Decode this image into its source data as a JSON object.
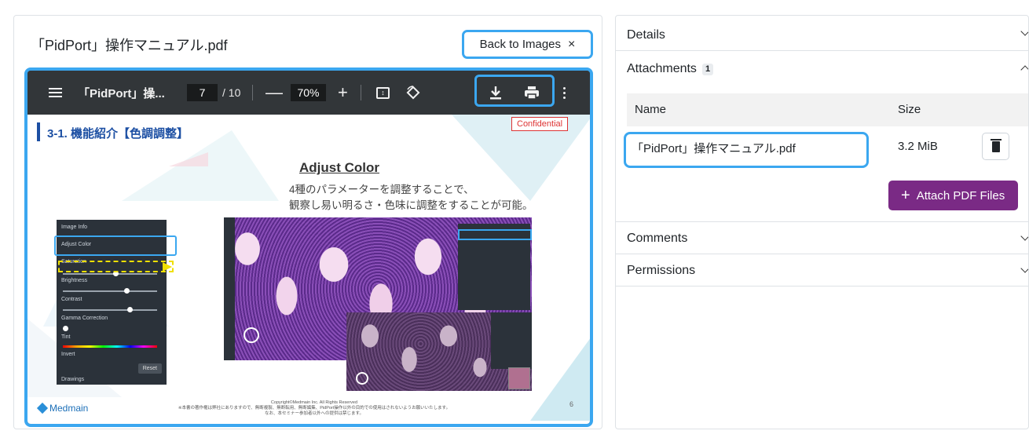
{
  "document": {
    "title": "「PidPort」操作マニュアル.pdf",
    "back_button": "Back to Images",
    "back_close": "×"
  },
  "viewer": {
    "title": "「PidPort」操...",
    "page_current": "7",
    "page_total": "/ 10",
    "zoom_minus": "—",
    "zoom": "70%",
    "zoom_plus": "+"
  },
  "pdf_page": {
    "section_title": "3-1. 機能紹介【色調調整】",
    "confidential": "Confidential",
    "heading": "Adjust Color",
    "desc_line1": "4種のパラメーターを調整することで、",
    "desc_line2": "観察し易い明るさ・色味に調整をすることが可能。",
    "panel": {
      "image_info": "Image Info",
      "adjust_color": "Adjust Color",
      "saturation": "Saturation",
      "brightness": "Brightness",
      "contrast": "Contrast",
      "gamma": "Gamma Correction",
      "tint": "Tint",
      "invert": "Invert",
      "reset": "Reset",
      "drawings": "Drawings"
    },
    "brand": "Medmain",
    "copyright1": "Copyright©Medmain Inc. All Rights Reserved",
    "copyright2": "※本書の著作権は弊社にありますので、無断複製、無断転用、無断編集、PidPort操作以外の目的での使用はされないようお願いいたします。",
    "copyright3": "なお、本セミナー参加者以外への提供は禁じます。",
    "page_number": "6"
  },
  "sidebar": {
    "details": "Details",
    "attachments": "Attachments",
    "attachments_count": "1",
    "table": {
      "col_name": "Name",
      "col_size": "Size",
      "rows": [
        {
          "name": "「PidPort」操作マニュアル.pdf",
          "size": "3.2 MiB"
        }
      ]
    },
    "attach_button": "Attach PDF Files",
    "comments": "Comments",
    "permissions": "Permissions"
  },
  "colors": {
    "highlight": "#3ba7f0",
    "toolbar_bg": "#323639",
    "attach_button": "#7a2a85",
    "section_blue": "#1c4fa3"
  },
  "icons": [
    "hamburger-icon",
    "fit-page-icon",
    "rotate-icon",
    "download-icon",
    "print-icon",
    "more-vertical-icon",
    "chevron-down-icon",
    "chevron-up-icon",
    "trash-icon",
    "plus-icon",
    "close-icon"
  ]
}
